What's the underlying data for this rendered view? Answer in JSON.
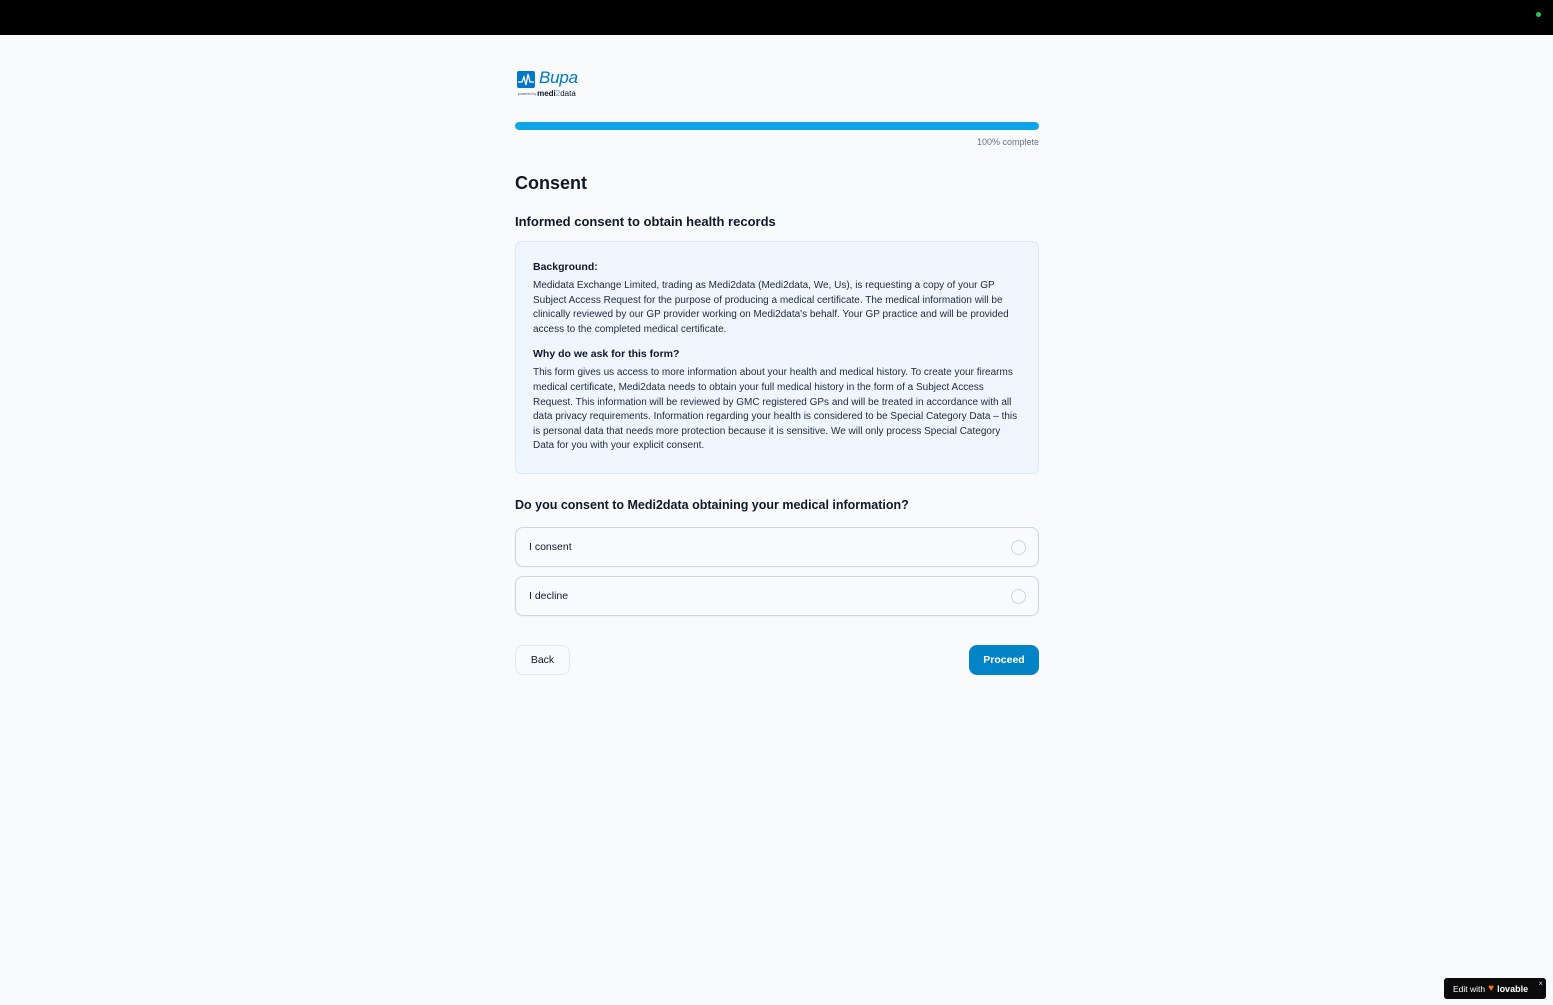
{
  "colors": {
    "accent": "#0284c7",
    "progress": "#0ea5e9",
    "status_dot": "#22c55e",
    "logo_blue": "#0077c8"
  },
  "logo": {
    "brand": "Bupa",
    "powered_by": "powered by",
    "partner_prefix": "medi",
    "partner_number": "2",
    "partner_suffix": "data"
  },
  "progress": {
    "percent": 100,
    "label": "100% complete"
  },
  "page": {
    "title": "Consent",
    "section_title": "Informed consent to obtain health records"
  },
  "info": {
    "background_heading": "Background:",
    "background_text": "Medidata Exchange Limited, trading as Medi2data (Medi2data, We, Us), is requesting a copy of your GP Subject Access Request for the purpose of producing a medical certificate. The medical information will be clinically reviewed by our GP provider working on Medi2data's behalf. Your GP practice and will be provided access to the completed medical certificate.",
    "why_heading": "Why do we ask for this form?",
    "why_text": "This form gives us access to more information about your health and medical history. To create your firearms medical certificate, Medi2data needs to obtain your full medical history in the form of a Subject Access Request. This information will be reviewed by GMC registered GPs and will be treated in accordance with all data privacy requirements. Information regarding your health is considered to be Special Category Data – this is personal data that needs more protection because it is sensitive. We will only process Special Category Data for you with your explicit consent."
  },
  "question": {
    "text": "Do you consent to Medi2data obtaining your medical information?",
    "options": [
      {
        "label": "I consent",
        "selected": false
      },
      {
        "label": "I decline",
        "selected": false
      }
    ]
  },
  "actions": {
    "back_label": "Back",
    "proceed_label": "Proceed"
  },
  "badge": {
    "edit_with": "Edit with",
    "brand": "lovable",
    "close": "×"
  }
}
